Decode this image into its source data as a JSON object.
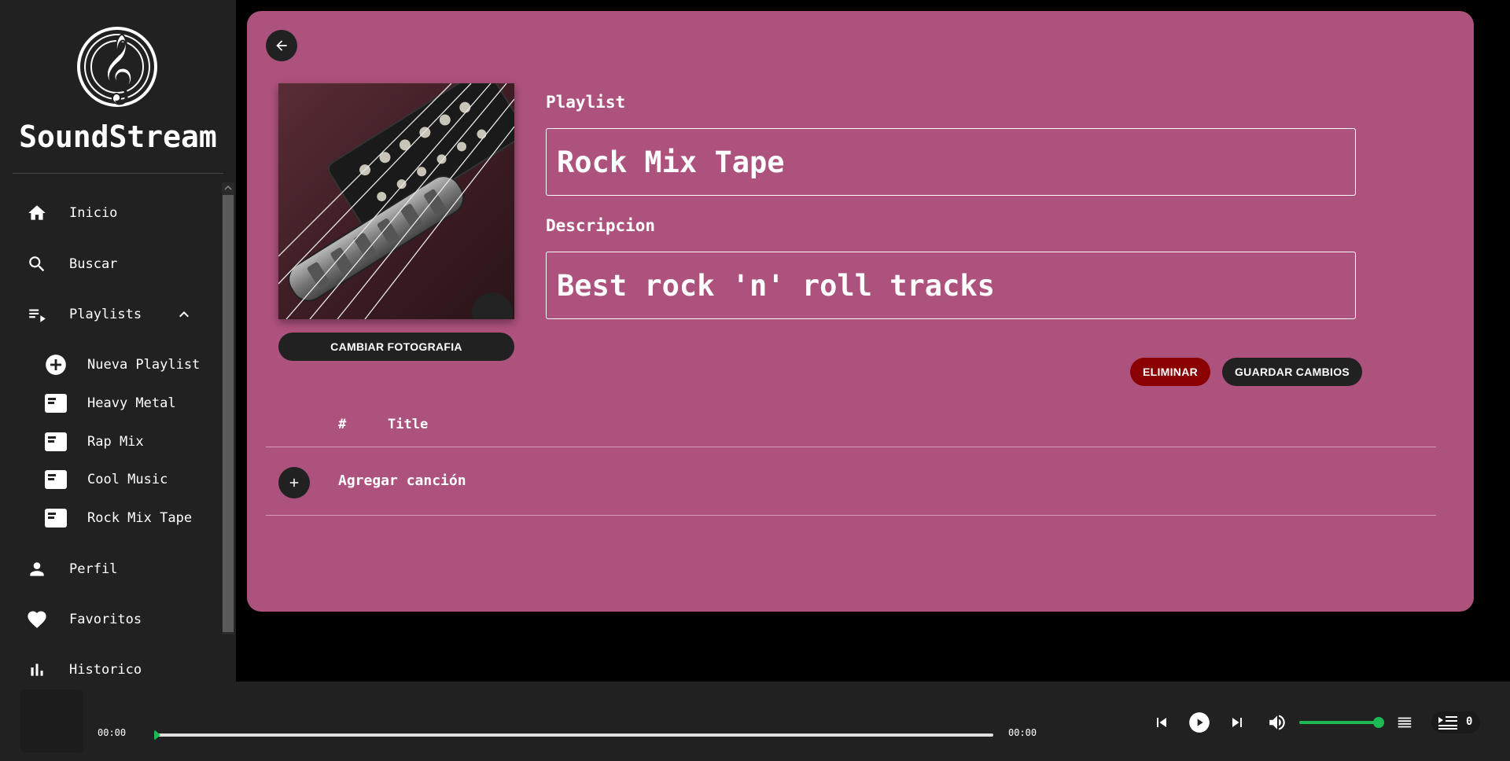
{
  "app": {
    "name": "SoundStream"
  },
  "sidebar": {
    "nav": [
      {
        "label": "Inicio",
        "icon": "home-icon"
      },
      {
        "label": "Buscar",
        "icon": "search-icon"
      },
      {
        "label": "Playlists",
        "icon": "playlist-icon",
        "expanded": true
      },
      {
        "label": "Perfil",
        "icon": "person-icon"
      },
      {
        "label": "Favoritos",
        "icon": "heart-icon"
      },
      {
        "label": "Historico",
        "icon": "bar-chart-icon"
      }
    ],
    "playlists": [
      {
        "label": "Nueva Playlist",
        "icon": "add-circle-icon"
      },
      {
        "label": "Heavy Metal",
        "icon": "playlist-card-icon"
      },
      {
        "label": "Rap Mix",
        "icon": "playlist-card-icon"
      },
      {
        "label": "Cool Music",
        "icon": "playlist-card-icon"
      },
      {
        "label": "Rock Mix Tape",
        "icon": "playlist-card-icon"
      }
    ]
  },
  "editor": {
    "playlist_label": "Playlist",
    "playlist_value": "Rock Mix Tape",
    "description_label": "Descripcion",
    "description_value": "Best rock 'n' roll tracks",
    "change_photo_label": "CAMBIAR FOTOGRAFIA",
    "delete_label": "ELIMINAR",
    "save_label": "GUARDAR CAMBIOS",
    "cover_image": "guitar-bridge-pickups-photo"
  },
  "tracks": {
    "columns": [
      "#",
      "Title"
    ],
    "add_song_label": "Agregar canción"
  },
  "player": {
    "current_time": "00:00",
    "total_time": "00:00",
    "progress": 0,
    "volume": 1.0,
    "queue_count": "0"
  },
  "colors": {
    "card_bg": "#ad527c",
    "sidebar_bg": "#212121",
    "accent_green": "#1db954",
    "delete_red": "#8b0000"
  }
}
